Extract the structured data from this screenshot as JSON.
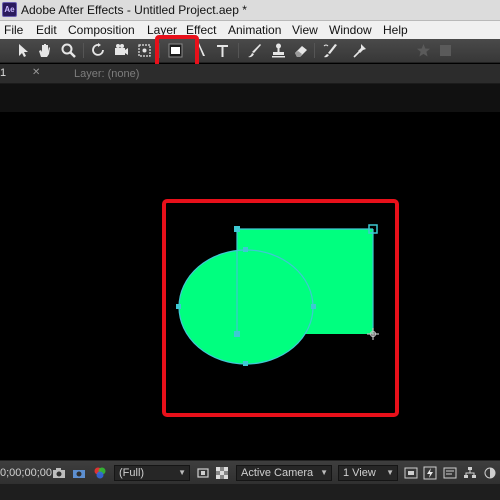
{
  "window": {
    "title": "Adobe After Effects - Untitled Project.aep *",
    "logo_text": "Ae"
  },
  "menu": [
    "File",
    "Edit",
    "Composition",
    "Layer",
    "Effect",
    "Animation",
    "View",
    "Window",
    "Help"
  ],
  "toolbar": {
    "tools": [
      "selection-tool-icon",
      "hand-tool-icon",
      "zoom-tool-icon",
      "rotation-tool-icon",
      "camera-tool-icon",
      "pan-behind-tool-icon",
      "rectangle-tool-icon",
      "pen-tool-icon",
      "type-tool-icon",
      "brush-tool-icon",
      "clone-stamp-tool-icon",
      "eraser-tool-icon",
      "roto-brush-tool-icon",
      "puppet-pin-tool-icon",
      "star-icon"
    ],
    "highlighted_tool": "rectangle-tool"
  },
  "panel": {
    "tab_label": "1",
    "layer_label": "Layer: (none)"
  },
  "composition": {
    "shape_color": "#00ff7f",
    "path_color": "#3ec9d3",
    "highlight_color": "#e8101a"
  },
  "status": {
    "timecode": "0;00;00;00",
    "resolution": "(Full)",
    "camera": "Active Camera",
    "view": "1 View"
  }
}
